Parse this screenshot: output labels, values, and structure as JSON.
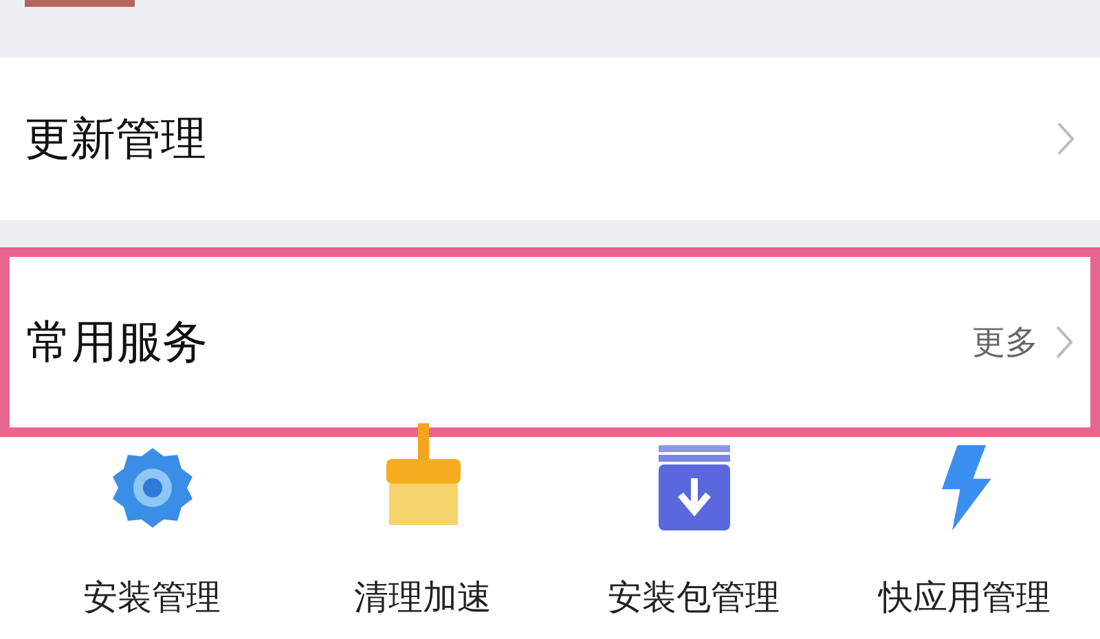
{
  "rows": [
    {
      "title": "更新管理",
      "highlighted": false
    },
    {
      "title": "常用服务",
      "more": "更多",
      "highlighted": true
    }
  ],
  "services": [
    {
      "label": "安装管理",
      "kind": "gear"
    },
    {
      "label": "清理加速",
      "kind": "brush"
    },
    {
      "label": "安装包管理",
      "kind": "package"
    },
    {
      "label": "快应用管理",
      "kind": "bolt"
    }
  ]
}
